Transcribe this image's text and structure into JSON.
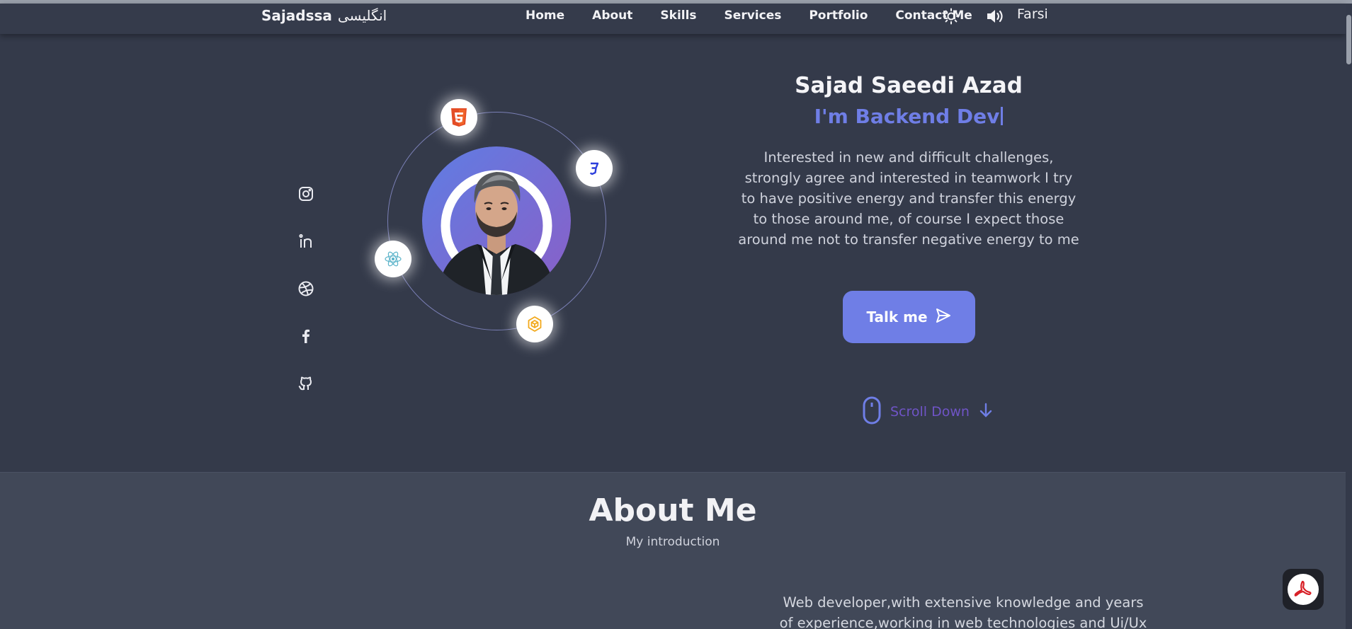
{
  "nav": {
    "brand": "Sajadssa",
    "brand_fa": "انگلیسی",
    "links": [
      "Home",
      "About",
      "Skills",
      "Services",
      "Portfolio",
      "Contact Me"
    ],
    "theme_icon": "sun-icon",
    "sound_icon": "speaker-icon",
    "language": "Farsi"
  },
  "socials": [
    "instagram-icon",
    "linkedin-icon",
    "dribbble-icon",
    "facebook-icon",
    "github-icon"
  ],
  "orbit_icons": [
    "html5-icon",
    "css3-icon",
    "react-icon",
    "webpack-icon"
  ],
  "hero": {
    "name": "Sajad Saeedi Azad",
    "role": "I'm Backend Dev",
    "description": "Interested in new and difficult challenges, strongly agree and interested in teamwork I try to have positive energy and transfer this energy to those around me, of course I expect those around me not to transfer negative energy to me",
    "button_label": "Talk me",
    "scroll_label": "Scroll Down"
  },
  "about": {
    "title": "About Me",
    "subtitle": "My introduction",
    "text": "Web developer,with extensive knowledge and years of experience,working in web technologies and Ui/Ux"
  },
  "colors": {
    "background": "#343a4a",
    "accent": "#6f7ee6",
    "about_background": "#414858",
    "scroll_text": "#6f54c6"
  }
}
